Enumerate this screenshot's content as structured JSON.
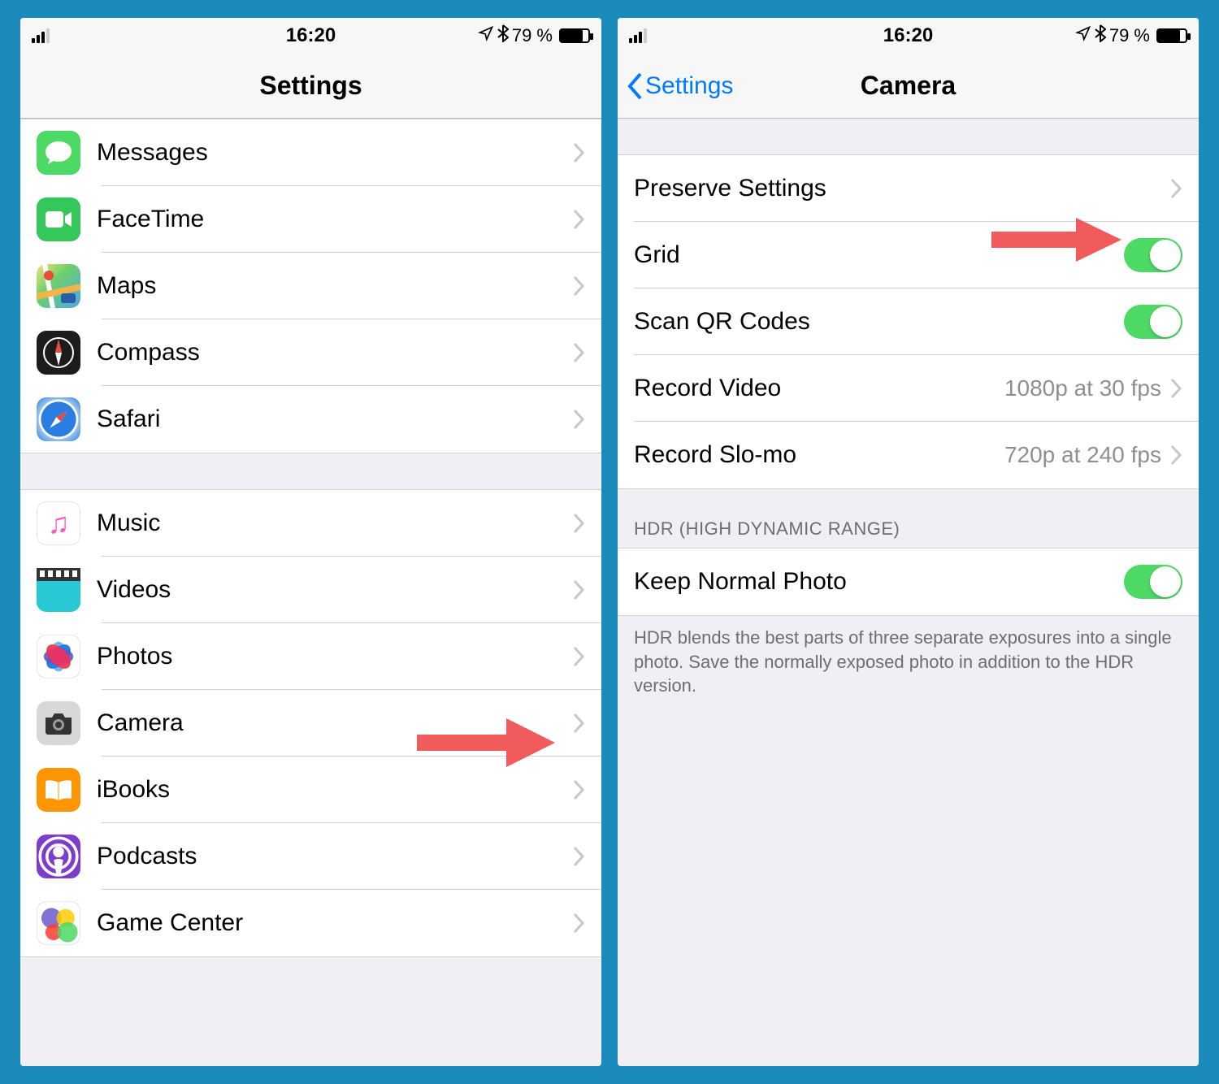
{
  "status": {
    "time": "16:20",
    "battery_pct": "79 %"
  },
  "left": {
    "title": "Settings",
    "group1": [
      {
        "label": "Messages"
      },
      {
        "label": "FaceTime"
      },
      {
        "label": "Maps"
      },
      {
        "label": "Compass"
      },
      {
        "label": "Safari"
      }
    ],
    "group2": [
      {
        "label": "Music"
      },
      {
        "label": "Videos"
      },
      {
        "label": "Photos"
      },
      {
        "label": "Camera"
      },
      {
        "label": "iBooks"
      },
      {
        "label": "Podcasts"
      },
      {
        "label": "Game Center"
      }
    ]
  },
  "right": {
    "back": "Settings",
    "title": "Camera",
    "rows": {
      "preserve": "Preserve Settings",
      "grid": "Grid",
      "scanqr": "Scan QR Codes",
      "recvideo": "Record Video",
      "recvideo_val": "1080p at 30 fps",
      "recslomo": "Record Slo-mo",
      "recslomo_val": "720p at 240 fps",
      "hdr_header": "HDR (HIGH DYNAMIC RANGE)",
      "keepnormal": "Keep Normal Photo",
      "hdr_footer": "HDR blends the best parts of three separate exposures into a single photo. Save the normally exposed photo in addition to the HDR version."
    }
  }
}
